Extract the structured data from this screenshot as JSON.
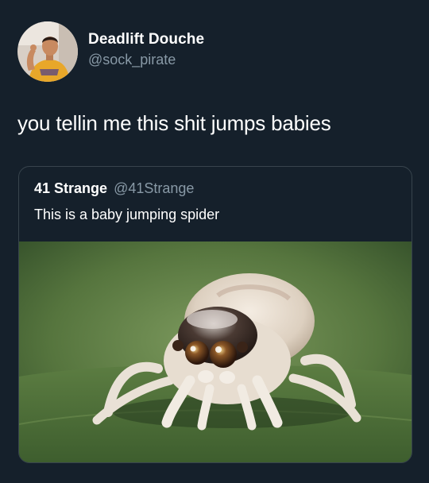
{
  "tweet": {
    "author": {
      "name": "Deadlift Douche",
      "handle": "@sock_pirate"
    },
    "text": "you tellin me this shit jumps babies",
    "avatar_icon": "person-avatar-photo",
    "quoted_tweet": {
      "author": {
        "name": "41 Strange",
        "handle": "@41Strange"
      },
      "text": "This is a baby jumping spider",
      "image": "baby-jumping-spider-photo"
    }
  },
  "colors": {
    "background": "#15202b",
    "primary_text": "#ffffff",
    "secondary_text": "#8899a6",
    "border": "#38444d"
  }
}
